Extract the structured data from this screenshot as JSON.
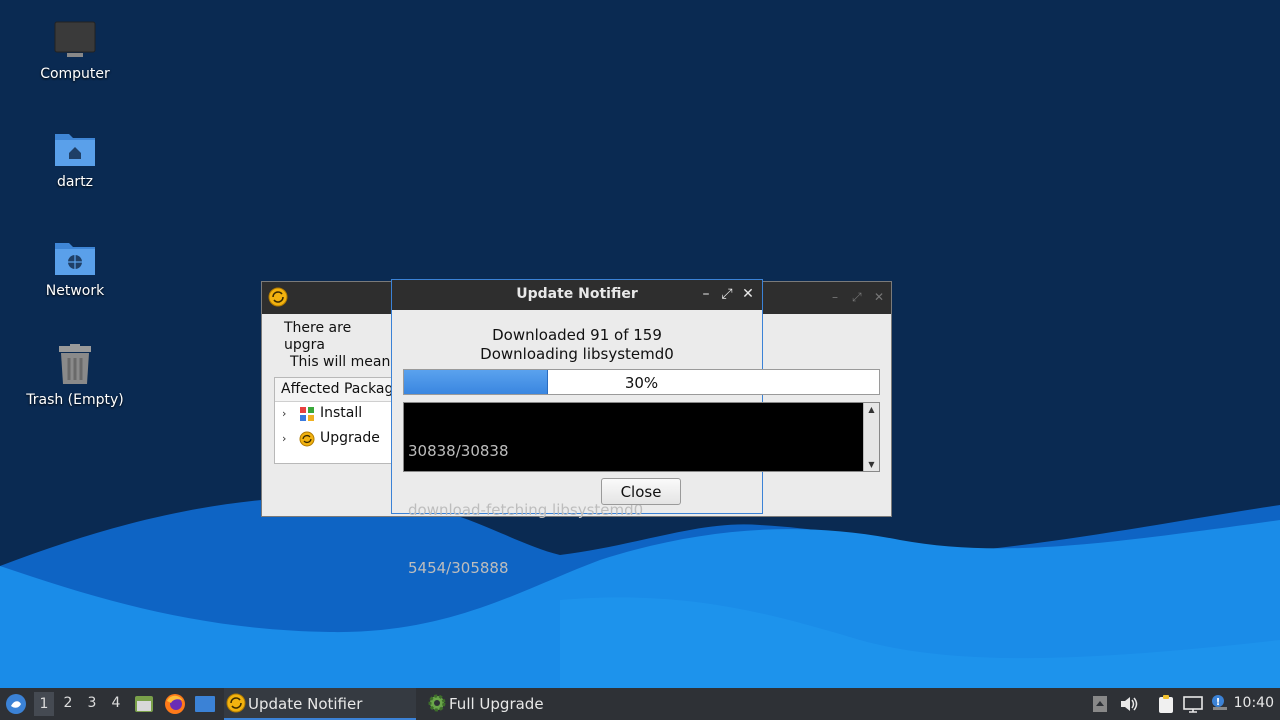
{
  "desktop": {
    "icons": [
      {
        "label": "Computer"
      },
      {
        "label": "dartz"
      },
      {
        "label": "Network"
      },
      {
        "label": "Trash (Empty)"
      }
    ]
  },
  "full_upgrade_window": {
    "intro_line1": "There are upgra",
    "intro_line2": "This will mean",
    "tree_header": "Affected Packag",
    "items": [
      {
        "label": "Install"
      },
      {
        "label": "Upgrade"
      }
    ]
  },
  "update_notifier_window": {
    "title": "Update Notifier",
    "status_line1": "Downloaded 91 of 159",
    "status_line2": "Downloading libsystemd0",
    "progress_text": "30%",
    "progress_value": 0.3,
    "log_lines": [
      "30838/30838",
      "download-fetching libsystemd0",
      "5454/305888"
    ],
    "close_label": "Close"
  },
  "taskbar": {
    "workspaces": [
      "1",
      "2",
      "3",
      "4"
    ],
    "active_workspace": "1",
    "tasks": [
      {
        "label": "Update Notifier",
        "icon": "update-notifier-icon",
        "active": true
      },
      {
        "label": "Full Upgrade",
        "icon": "gear-icon",
        "active": false
      }
    ],
    "clock": "10:40"
  },
  "colors": {
    "desktop_bg": "#0a2a52",
    "wave_light": "#1a8ce8",
    "accent": "#3b82d6",
    "titlebar": "#2e2e2e"
  }
}
